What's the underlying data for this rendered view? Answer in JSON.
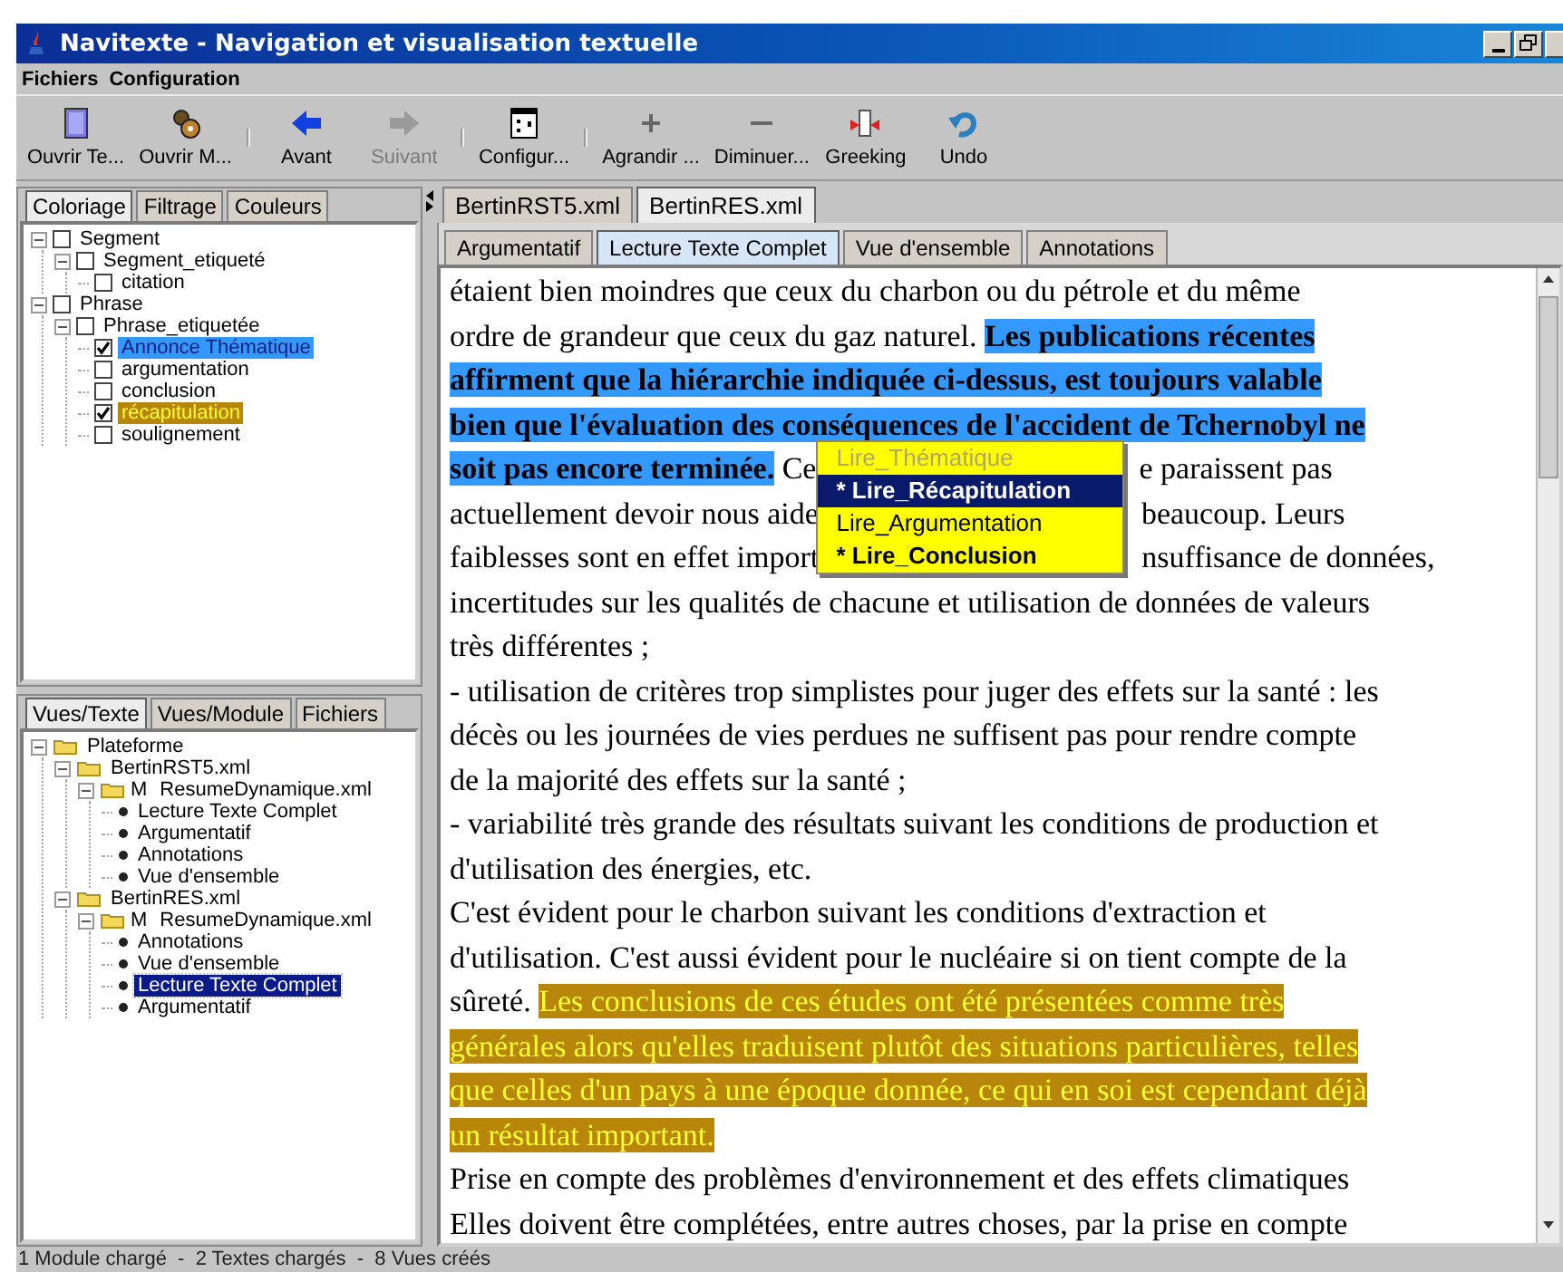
{
  "window": {
    "title": "Navitexte - Navigation et visualisation textuelle"
  },
  "menu": [
    "Fichiers",
    "Configuration"
  ],
  "toolbar": [
    {
      "label": "Ouvrir Te...",
      "kind": "document",
      "disabled": false,
      "separator": false
    },
    {
      "label": "Ouvrir M...",
      "kind": "gears",
      "disabled": false,
      "separator": false
    },
    {
      "label": "Avant",
      "kind": "back",
      "disabled": false,
      "separator": true
    },
    {
      "label": "Suivant",
      "kind": "forward",
      "disabled": true,
      "separator": false
    },
    {
      "label": "Configur...",
      "kind": "config",
      "disabled": false,
      "separator": true
    },
    {
      "label": "Agrandir ...",
      "kind": "plus",
      "disabled": false,
      "separator": true
    },
    {
      "label": "Diminuer...",
      "kind": "minus",
      "disabled": false,
      "separator": false
    },
    {
      "label": "Greeking",
      "kind": "greeking",
      "disabled": false,
      "separator": false
    },
    {
      "label": "Undo",
      "kind": "undo",
      "disabled": false,
      "separator": false
    }
  ],
  "coloring_panel": {
    "tabs": [
      {
        "label": "Coloriage",
        "selected": true
      },
      {
        "label": "Filtrage",
        "selected": false
      },
      {
        "label": "Couleurs",
        "selected": false
      }
    ],
    "tree": [
      {
        "label": "Segment",
        "checked": false,
        "expanded": true,
        "children": [
          {
            "label": "Segment_etiqueté",
            "checked": false,
            "expanded": true,
            "children": [
              {
                "label": "citation",
                "checked": false
              }
            ]
          }
        ]
      },
      {
        "label": "Phrase",
        "checked": false,
        "expanded": true,
        "children": [
          {
            "label": "Phrase_etiquetée",
            "checked": false,
            "expanded": true,
            "children": [
              {
                "label": "Annonce Thématique",
                "checked": true,
                "color": "#3399ff"
              },
              {
                "label": "argumentation",
                "checked": false
              },
              {
                "label": "conclusion",
                "checked": false
              },
              {
                "label": "récapitulation",
                "checked": true,
                "color": "#b8860b"
              },
              {
                "label": "soulignement",
                "checked": false
              }
            ]
          }
        ]
      }
    ]
  },
  "views_panel": {
    "tabs": [
      {
        "label": "Vues/Texte",
        "selected": true
      },
      {
        "label": "Vues/Module",
        "selected": false
      },
      {
        "label": "Fichiers",
        "selected": false
      }
    ],
    "tree": [
      {
        "label": "Plateforme",
        "kind": "folder",
        "selected": false,
        "expanded": true,
        "children": [
          {
            "label": "BertinRST5.xml",
            "kind": "folder",
            "selected": false,
            "expanded": true,
            "children": [
              {
                "label": "ResumeDynamique.xml",
                "prefix": "M",
                "kind": "folder",
                "selected": false,
                "expanded": true,
                "children": [
                  {
                    "label": "Lecture Texte Complet",
                    "kind": "view",
                    "selected": false
                  },
                  {
                    "label": "Argumentatif",
                    "kind": "view",
                    "selected": false
                  },
                  {
                    "label": "Annotations",
                    "kind": "view",
                    "selected": false
                  },
                  {
                    "label": "Vue d'ensemble",
                    "kind": "view",
                    "selected": false
                  }
                ]
              }
            ]
          },
          {
            "label": "BertinRES.xml",
            "kind": "folder",
            "selected": false,
            "expanded": true,
            "children": [
              {
                "label": "ResumeDynamique.xml",
                "prefix": "M",
                "kind": "folder",
                "selected": false,
                "expanded": true,
                "children": [
                  {
                    "label": "Annotations",
                    "kind": "view",
                    "selected": false
                  },
                  {
                    "label": "Vue d'ensemble",
                    "kind": "view",
                    "selected": false
                  },
                  {
                    "label": "Lecture Texte Complet",
                    "kind": "view",
                    "selected": true
                  },
                  {
                    "label": "Argumentatif",
                    "kind": "view",
                    "selected": false
                  }
                ]
              }
            ]
          }
        ]
      }
    ]
  },
  "document_tabs": [
    {
      "label": "BertinRST5.xml",
      "selected": false
    },
    {
      "label": "BertinRES.xml",
      "selected": true
    }
  ],
  "view_tabs": [
    {
      "label": "Argumentatif",
      "selected": false
    },
    {
      "label": "Lecture Texte Complet",
      "selected": true
    },
    {
      "label": "Vue d'ensemble",
      "selected": false
    },
    {
      "label": "Annotations",
      "selected": false
    }
  ],
  "text": {
    "lines": [
      [
        {
          "kind": "plain",
          "text": "étaient bien moindres que ceux du charbon ou du pétrole et du même"
        }
      ],
      [
        {
          "kind": "plain",
          "text": "ordre de grandeur que ceux du gaz naturel. "
        },
        {
          "kind": "thematic",
          "text": "Les publications récentes"
        }
      ],
      [
        {
          "kind": "thematic",
          "text": "affirment que la hiérarchie indiquée ci-dessus, est toujours valable"
        }
      ],
      [
        {
          "kind": "thematic",
          "text": "bien que l'évaluation des conséquences de l'accident de Tchernobyl ne"
        }
      ],
      [
        {
          "kind": "thematic",
          "text": "soit pas encore terminée."
        },
        {
          "kind": "plain",
          "text": " Ce"
        },
        {
          "kind": "covered"
        },
        {
          "kind": "plain",
          "text": "e paraissent pas"
        }
      ],
      [
        {
          "kind": "plain",
          "text": "actuellement devoir nous aide"
        },
        {
          "kind": "covered"
        },
        {
          "kind": "plain",
          "text": "beaucoup. Leurs"
        }
      ],
      [
        {
          "kind": "plain",
          "text": "faiblesses sont en effet import"
        },
        {
          "kind": "covered"
        },
        {
          "kind": "plain",
          "text": "nsuffisance de données,"
        }
      ],
      [
        {
          "kind": "plain",
          "text": "incertitudes sur les qualités de chacune et utilisation de données de valeurs"
        }
      ],
      [
        {
          "kind": "plain",
          "text": "très différentes ;"
        }
      ],
      [
        {
          "kind": "plain",
          "text": "- utilisation de critères trop simplistes pour juger des effets sur la santé : les"
        }
      ],
      [
        {
          "kind": "plain",
          "text": "décès ou les journées de vies perdues ne suffisent pas pour rendre compte"
        }
      ],
      [
        {
          "kind": "plain",
          "text": "de la majorité des effets sur la santé ;"
        }
      ],
      [
        {
          "kind": "plain",
          "text": "- variabilité très grande des résultats suivant les conditions de production et"
        }
      ],
      [
        {
          "kind": "plain",
          "text": "d'utilisation des énergies, etc."
        }
      ],
      [
        {
          "kind": "plain",
          "text": "C'est évident pour le charbon suivant les conditions d'extraction et"
        }
      ],
      [
        {
          "kind": "plain",
          "text": "d'utilisation. C'est aussi évident pour le nucléaire si on tient compte de la"
        }
      ],
      [
        {
          "kind": "plain",
          "text": "sûreté. "
        },
        {
          "kind": "recap",
          "text": "Les conclusions de ces études ont été présentées comme très"
        }
      ],
      [
        {
          "kind": "recap",
          "text": "générales alors qu'elles traduisent plutôt des situations particulières, telles"
        }
      ],
      [
        {
          "kind": "recap",
          "text": "que celles d'un pays à une époque donnée, ce qui en soi est cependant déjà"
        }
      ],
      [
        {
          "kind": "recap",
          "text": "un résultat important."
        }
      ],
      [
        {
          "kind": "plain",
          "text": "Prise en compte des problèmes d'environnement et des effets climatiques"
        }
      ],
      [
        {
          "kind": "plain",
          "text": "Elles doivent être complétées, entre autres choses, par la prise en compte"
        }
      ]
    ]
  },
  "popup": {
    "items": [
      {
        "label": "Lire_Thématique",
        "selected": false,
        "disabled": true,
        "active": false
      },
      {
        "label": "* Lire_Récapitulation",
        "selected": true,
        "disabled": false,
        "active": true
      },
      {
        "label": "Lire_Argumentation",
        "selected": false,
        "disabled": false,
        "active": false
      },
      {
        "label": "* Lire_Conclusion",
        "selected": false,
        "disabled": false,
        "active": true
      }
    ]
  },
  "status_bar": "1 Module chargé  -  2 Textes chargés  -  8 Vues créés"
}
